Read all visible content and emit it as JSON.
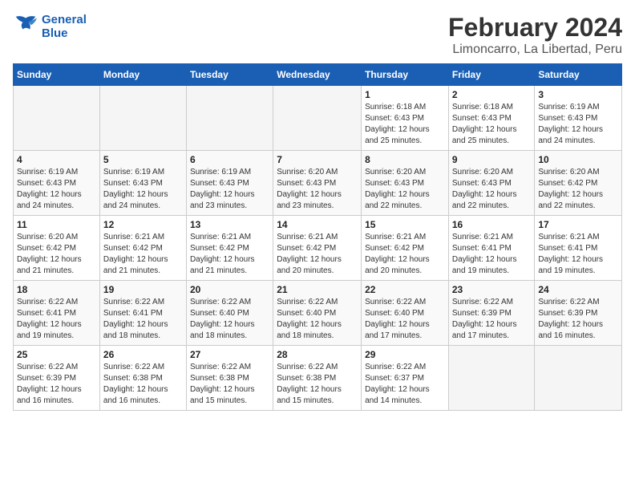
{
  "header": {
    "logo_line1": "General",
    "logo_line2": "Blue",
    "month": "February 2024",
    "location": "Limoncarro, La Libertad, Peru"
  },
  "weekdays": [
    "Sunday",
    "Monday",
    "Tuesday",
    "Wednesday",
    "Thursday",
    "Friday",
    "Saturday"
  ],
  "weeks": [
    [
      {
        "day": "",
        "info": ""
      },
      {
        "day": "",
        "info": ""
      },
      {
        "day": "",
        "info": ""
      },
      {
        "day": "",
        "info": ""
      },
      {
        "day": "1",
        "info": "Sunrise: 6:18 AM\nSunset: 6:43 PM\nDaylight: 12 hours\nand 25 minutes."
      },
      {
        "day": "2",
        "info": "Sunrise: 6:18 AM\nSunset: 6:43 PM\nDaylight: 12 hours\nand 25 minutes."
      },
      {
        "day": "3",
        "info": "Sunrise: 6:19 AM\nSunset: 6:43 PM\nDaylight: 12 hours\nand 24 minutes."
      }
    ],
    [
      {
        "day": "4",
        "info": "Sunrise: 6:19 AM\nSunset: 6:43 PM\nDaylight: 12 hours\nand 24 minutes."
      },
      {
        "day": "5",
        "info": "Sunrise: 6:19 AM\nSunset: 6:43 PM\nDaylight: 12 hours\nand 24 minutes."
      },
      {
        "day": "6",
        "info": "Sunrise: 6:19 AM\nSunset: 6:43 PM\nDaylight: 12 hours\nand 23 minutes."
      },
      {
        "day": "7",
        "info": "Sunrise: 6:20 AM\nSunset: 6:43 PM\nDaylight: 12 hours\nand 23 minutes."
      },
      {
        "day": "8",
        "info": "Sunrise: 6:20 AM\nSunset: 6:43 PM\nDaylight: 12 hours\nand 22 minutes."
      },
      {
        "day": "9",
        "info": "Sunrise: 6:20 AM\nSunset: 6:43 PM\nDaylight: 12 hours\nand 22 minutes."
      },
      {
        "day": "10",
        "info": "Sunrise: 6:20 AM\nSunset: 6:42 PM\nDaylight: 12 hours\nand 22 minutes."
      }
    ],
    [
      {
        "day": "11",
        "info": "Sunrise: 6:20 AM\nSunset: 6:42 PM\nDaylight: 12 hours\nand 21 minutes."
      },
      {
        "day": "12",
        "info": "Sunrise: 6:21 AM\nSunset: 6:42 PM\nDaylight: 12 hours\nand 21 minutes."
      },
      {
        "day": "13",
        "info": "Sunrise: 6:21 AM\nSunset: 6:42 PM\nDaylight: 12 hours\nand 21 minutes."
      },
      {
        "day": "14",
        "info": "Sunrise: 6:21 AM\nSunset: 6:42 PM\nDaylight: 12 hours\nand 20 minutes."
      },
      {
        "day": "15",
        "info": "Sunrise: 6:21 AM\nSunset: 6:42 PM\nDaylight: 12 hours\nand 20 minutes."
      },
      {
        "day": "16",
        "info": "Sunrise: 6:21 AM\nSunset: 6:41 PM\nDaylight: 12 hours\nand 19 minutes."
      },
      {
        "day": "17",
        "info": "Sunrise: 6:21 AM\nSunset: 6:41 PM\nDaylight: 12 hours\nand 19 minutes."
      }
    ],
    [
      {
        "day": "18",
        "info": "Sunrise: 6:22 AM\nSunset: 6:41 PM\nDaylight: 12 hours\nand 19 minutes."
      },
      {
        "day": "19",
        "info": "Sunrise: 6:22 AM\nSunset: 6:41 PM\nDaylight: 12 hours\nand 18 minutes."
      },
      {
        "day": "20",
        "info": "Sunrise: 6:22 AM\nSunset: 6:40 PM\nDaylight: 12 hours\nand 18 minutes."
      },
      {
        "day": "21",
        "info": "Sunrise: 6:22 AM\nSunset: 6:40 PM\nDaylight: 12 hours\nand 18 minutes."
      },
      {
        "day": "22",
        "info": "Sunrise: 6:22 AM\nSunset: 6:40 PM\nDaylight: 12 hours\nand 17 minutes."
      },
      {
        "day": "23",
        "info": "Sunrise: 6:22 AM\nSunset: 6:39 PM\nDaylight: 12 hours\nand 17 minutes."
      },
      {
        "day": "24",
        "info": "Sunrise: 6:22 AM\nSunset: 6:39 PM\nDaylight: 12 hours\nand 16 minutes."
      }
    ],
    [
      {
        "day": "25",
        "info": "Sunrise: 6:22 AM\nSunset: 6:39 PM\nDaylight: 12 hours\nand 16 minutes."
      },
      {
        "day": "26",
        "info": "Sunrise: 6:22 AM\nSunset: 6:38 PM\nDaylight: 12 hours\nand 16 minutes."
      },
      {
        "day": "27",
        "info": "Sunrise: 6:22 AM\nSunset: 6:38 PM\nDaylight: 12 hours\nand 15 minutes."
      },
      {
        "day": "28",
        "info": "Sunrise: 6:22 AM\nSunset: 6:38 PM\nDaylight: 12 hours\nand 15 minutes."
      },
      {
        "day": "29",
        "info": "Sunrise: 6:22 AM\nSunset: 6:37 PM\nDaylight: 12 hours\nand 14 minutes."
      },
      {
        "day": "",
        "info": ""
      },
      {
        "day": "",
        "info": ""
      }
    ]
  ]
}
